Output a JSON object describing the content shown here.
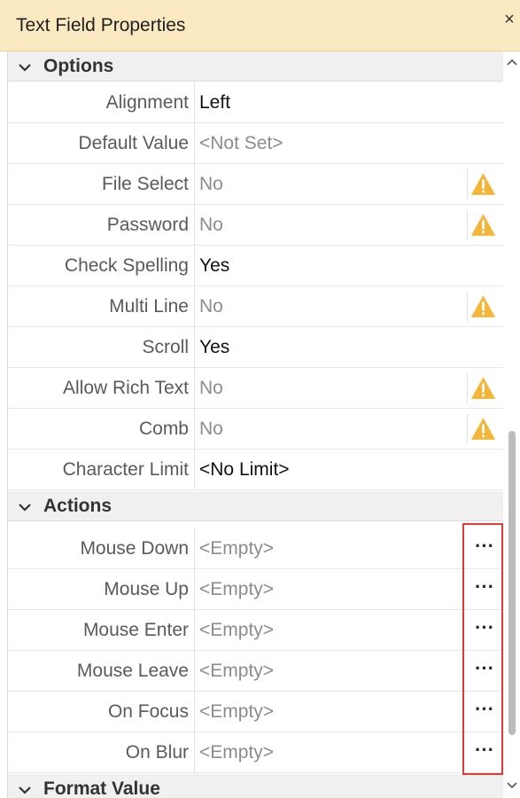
{
  "panel": {
    "title": "Text Field Properties",
    "close_glyph": "×"
  },
  "sections": {
    "options": {
      "label": "Options",
      "icon": "chevron-down-icon"
    },
    "actions": {
      "label": "Actions",
      "icon": "chevron-down-icon"
    },
    "format_value": {
      "label": "Format Value",
      "icon": "chevron-down-icon"
    }
  },
  "options": [
    {
      "name": "Alignment",
      "value": "Left",
      "state": "set",
      "warning": false
    },
    {
      "name": "Default Value",
      "value": "<Not Set>",
      "state": "unset",
      "warning": false
    },
    {
      "name": "File Select",
      "value": "No",
      "state": "unset",
      "warning": true
    },
    {
      "name": "Password",
      "value": "No",
      "state": "unset",
      "warning": true
    },
    {
      "name": "Check Spelling",
      "value": "Yes",
      "state": "set",
      "warning": false
    },
    {
      "name": "Multi Line",
      "value": "No",
      "state": "unset",
      "warning": true
    },
    {
      "name": "Scroll",
      "value": "Yes",
      "state": "set",
      "warning": false
    },
    {
      "name": "Allow Rich Text",
      "value": "No",
      "state": "unset",
      "warning": true
    },
    {
      "name": "Comb",
      "value": "No",
      "state": "unset",
      "warning": true
    },
    {
      "name": "Character Limit",
      "value": "<No Limit>",
      "state": "set",
      "warning": false
    }
  ],
  "actions": [
    {
      "name": "Mouse Down",
      "value": "<Empty>",
      "button": "···"
    },
    {
      "name": "Mouse Up",
      "value": "<Empty>",
      "button": "···"
    },
    {
      "name": "Mouse Enter",
      "value": "<Empty>",
      "button": "···"
    },
    {
      "name": "Mouse Leave",
      "value": "<Empty>",
      "button": "···"
    },
    {
      "name": "On Focus",
      "value": "<Empty>",
      "button": "···"
    },
    {
      "name": "On Blur",
      "value": "<Empty>",
      "button": "···"
    }
  ],
  "colors": {
    "titlebar_bg": "#fbe9c2",
    "section_bg": "#f0f0f0",
    "warning_fill": "#f4b63a",
    "highlight_border": "#e53935",
    "unset_text": "#8c8c8c"
  }
}
